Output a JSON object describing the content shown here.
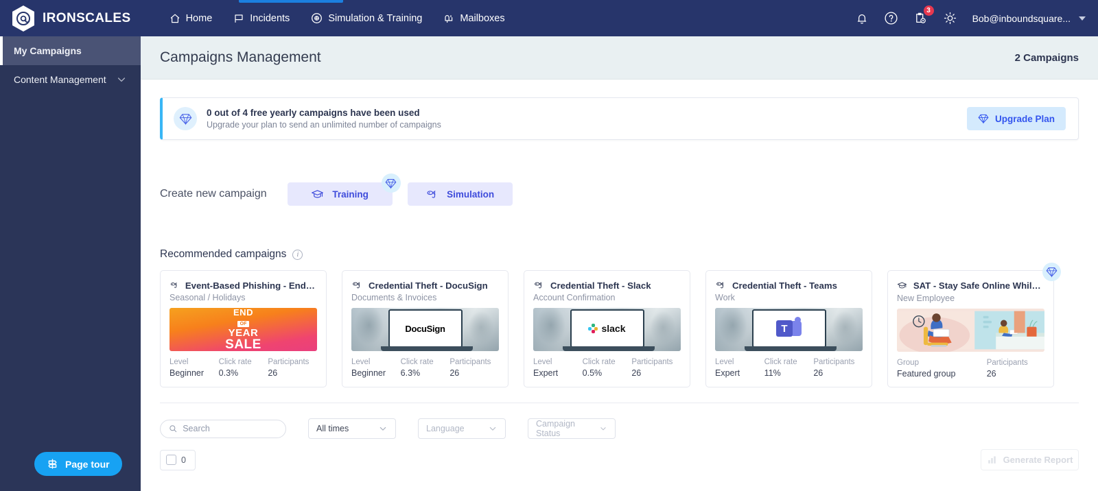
{
  "topnav": {
    "brand": "IRONSCALES",
    "links": [
      {
        "label": "Home",
        "icon": "home-icon"
      },
      {
        "label": "Incidents",
        "icon": "flag-icon"
      },
      {
        "label": "Simulation & Training",
        "icon": "target-icon"
      },
      {
        "label": "Mailboxes",
        "icon": "mailbox-icon"
      }
    ],
    "active_link": "Simulation & Training",
    "icons": {
      "bell": "bell-icon",
      "help": "question-circle-icon",
      "reports": "clipboard-gear-icon",
      "reports_badge": "3",
      "settings": "gear-icon"
    },
    "user": "Bob@inboundsquare..."
  },
  "sidebar": {
    "items": [
      {
        "label": "My Campaigns",
        "active": true,
        "chevron": false
      },
      {
        "label": "Content Management",
        "active": false,
        "chevron": true
      }
    ],
    "page_tour": "Page tour"
  },
  "header": {
    "title": "Campaigns Management",
    "count": "2 Campaigns"
  },
  "banner": {
    "icon": "diamond-icon",
    "title": "0 out of 4 free yearly campaigns have been used",
    "subtitle": "Upgrade your plan to send an unlimited number of campaigns",
    "cta": "Upgrade Plan",
    "cta_icon": "diamond-icon",
    "accent_color": "#39b6f5"
  },
  "create": {
    "label": "Create new campaign",
    "buttons": [
      {
        "label": "Training",
        "icon": "graduation-cap-icon",
        "gem": true
      },
      {
        "label": "Simulation",
        "icon": "phishing-hook-icon",
        "gem": false
      }
    ]
  },
  "recommended": {
    "title": "Recommended campaigns",
    "info_icon": "info-icon",
    "cards": [
      {
        "title": "Event-Based Phishing - End of ye...",
        "subtitle": "Seasonal / Holidays",
        "icon": "phishing-hook-icon",
        "thumb": "end-of-year-sale",
        "thumb_text": {
          "line1": "END",
          "line2": "OF",
          "line3": "YEAR",
          "line4": "SALE"
        },
        "stats": [
          {
            "label": "Level",
            "value": "Beginner"
          },
          {
            "label": "Click rate",
            "value": "0.3%"
          },
          {
            "label": "Participants",
            "value": "26"
          }
        ],
        "gem": false
      },
      {
        "title": "Credential Theft - DocuSign",
        "subtitle": "Documents & Invoices",
        "icon": "phishing-hook-icon",
        "thumb": "docusign-laptop",
        "thumb_text": {
          "brand": "DocuSign"
        },
        "stats": [
          {
            "label": "Level",
            "value": "Beginner"
          },
          {
            "label": "Click rate",
            "value": "6.3%"
          },
          {
            "label": "Participants",
            "value": "26"
          }
        ],
        "gem": false
      },
      {
        "title": "Credential Theft - Slack",
        "subtitle": "Account Confirmation",
        "icon": "phishing-hook-icon",
        "thumb": "slack-laptop",
        "thumb_text": {
          "brand": "slack"
        },
        "stats": [
          {
            "label": "Level",
            "value": "Expert"
          },
          {
            "label": "Click rate",
            "value": "0.5%"
          },
          {
            "label": "Participants",
            "value": "26"
          }
        ],
        "gem": false
      },
      {
        "title": "Credential Theft - Teams",
        "subtitle": "Work",
        "icon": "phishing-hook-icon",
        "thumb": "teams-laptop",
        "thumb_text": {
          "brand": "T"
        },
        "stats": [
          {
            "label": "Level",
            "value": "Expert"
          },
          {
            "label": "Click rate",
            "value": "11%"
          },
          {
            "label": "Participants",
            "value": "26"
          }
        ],
        "gem": false
      },
      {
        "title": "SAT - Stay Safe Online While Wor...",
        "subtitle": "New Employee",
        "icon": "graduation-cap-icon",
        "thumb": "remote-work-illustration",
        "thumb_text": {},
        "stats": [
          {
            "label": "Group",
            "value": "Featured group"
          },
          {
            "label": "Participants",
            "value": "26"
          }
        ],
        "gem": true
      }
    ]
  },
  "filters": {
    "search_placeholder": "Search",
    "search_value": "",
    "search_icon": "search-icon",
    "time_filter": "All times",
    "language_filter": "Language",
    "status_filter": "Campaign Status",
    "selected_count": "0",
    "generate_report": "Generate Report",
    "generate_report_icon": "bar-chart-icon"
  }
}
